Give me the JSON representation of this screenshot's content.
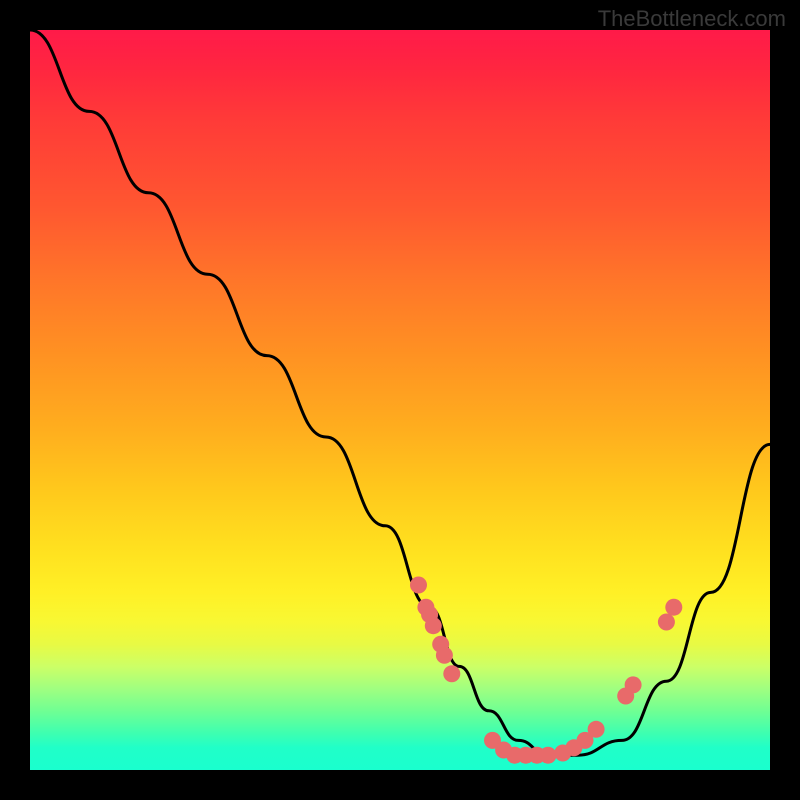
{
  "attribution": "TheBottleneck.com",
  "chart_data": {
    "type": "line",
    "title": "",
    "xlabel": "",
    "ylabel": "",
    "xlim": [
      0,
      100
    ],
    "ylim": [
      0,
      100
    ],
    "curve": {
      "x": [
        0,
        8,
        16,
        24,
        32,
        40,
        48,
        54,
        58,
        62,
        66,
        70,
        74,
        80,
        86,
        92,
        100
      ],
      "y": [
        100,
        89,
        78,
        67,
        56,
        45,
        33,
        22,
        14,
        8,
        4,
        2,
        2,
        4,
        12,
        24,
        44
      ]
    },
    "scatter": {
      "x": [
        52.5,
        53.5,
        54.0,
        54.5,
        55.5,
        56.0,
        57.0,
        62.5,
        64.0,
        65.5,
        67.0,
        68.5,
        70.0,
        72.0,
        73.5,
        75.0,
        76.5,
        80.5,
        81.5,
        86.0,
        87.0
      ],
      "y": [
        25.0,
        22.0,
        21.0,
        19.5,
        17.0,
        15.5,
        13.0,
        4.0,
        2.7,
        2.0,
        2.0,
        2.0,
        2.0,
        2.3,
        3.0,
        4.0,
        5.5,
        10.0,
        11.5,
        20.0,
        22.0
      ]
    },
    "gradient_stops": [
      {
        "pct": 0,
        "color": "#ff1a49"
      },
      {
        "pct": 50,
        "color": "#ffb81e"
      },
      {
        "pct": 80,
        "color": "#f8f833"
      },
      {
        "pct": 100,
        "color": "#1affce"
      }
    ],
    "point_color": "#e86a6a",
    "curve_color": "#000000"
  }
}
